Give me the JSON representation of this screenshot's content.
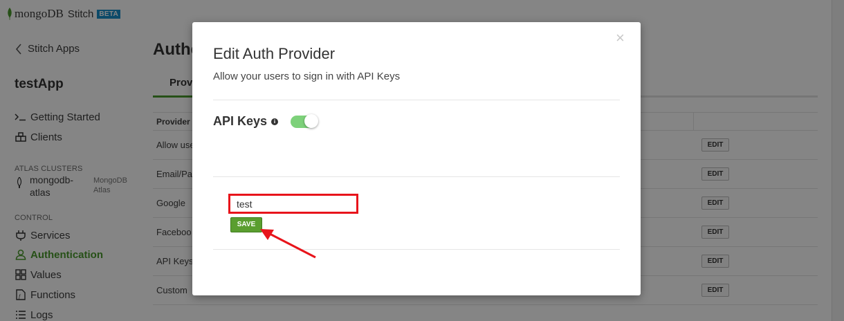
{
  "brand": {
    "wordmark": "mongoDB",
    "product": "Stitch",
    "badge": "BETA"
  },
  "sidebar": {
    "back_label": "Stitch Apps",
    "app_name": "testApp",
    "items": [
      {
        "label": "Getting Started",
        "icon": "terminal-icon"
      },
      {
        "label": "Clients",
        "icon": "clients-icon"
      }
    ],
    "clusters_heading": "ATLAS CLUSTERS",
    "cluster": {
      "name": "mongodb-atlas",
      "type": "MongoDB Atlas"
    },
    "control_heading": "CONTROL",
    "control_items": [
      {
        "label": "Services",
        "icon": "plug-icon",
        "active": false
      },
      {
        "label": "Authentication",
        "icon": "user-icon",
        "active": true
      },
      {
        "label": "Values",
        "icon": "grid-icon",
        "active": false
      },
      {
        "label": "Functions",
        "icon": "function-icon",
        "active": false
      },
      {
        "label": "Logs",
        "icon": "list-icon",
        "active": false
      }
    ]
  },
  "main": {
    "title": "Authe",
    "tab": "Provi",
    "table": {
      "header": "Provider",
      "rows": [
        {
          "name": "Allow use",
          "action": "EDIT"
        },
        {
          "name": "Email/Pa",
          "action": "EDIT"
        },
        {
          "name": "Google",
          "action": "EDIT"
        },
        {
          "name": "Faceboo",
          "action": "EDIT"
        },
        {
          "name": "API Keys",
          "action": "EDIT"
        },
        {
          "name": "Custom",
          "action": "EDIT"
        }
      ]
    }
  },
  "modal": {
    "close_symbol": "×",
    "title": "Edit Auth Provider",
    "subtitle": "Allow your users to sign in with API Keys",
    "section_label": "API Keys",
    "info_symbol": "i",
    "toggle_enabled": true,
    "key_input_value": "test",
    "save_label": "SAVE"
  },
  "colors": {
    "accent_green": "#4a9a2c",
    "toggle_on": "#7dd17a",
    "highlight_red": "#e8141b",
    "beta_blue": "#1a8ec9"
  }
}
